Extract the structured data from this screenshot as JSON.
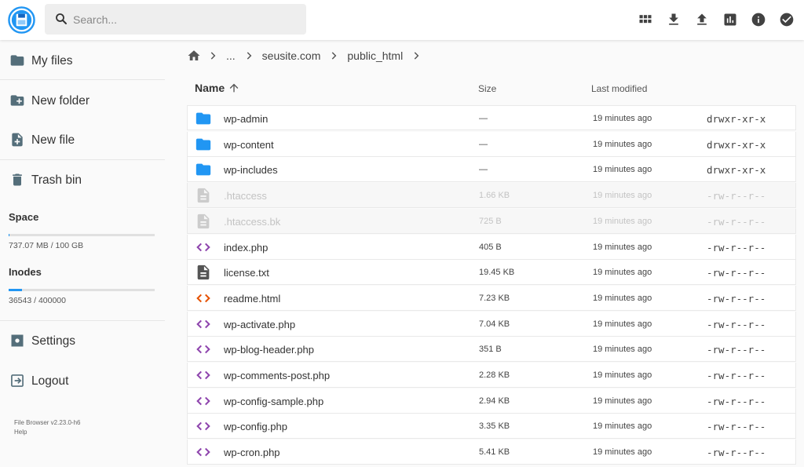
{
  "colors": {
    "accent": "#2196f3",
    "folder": "#2196f3",
    "php_icon": "#8e44ad",
    "html_icon": "#e65100",
    "doc_icon": "#555555",
    "hidden_icon": "#cccccc"
  },
  "header": {
    "logo_icon": "floppy-disk-icon",
    "search": {
      "placeholder": "Search..."
    },
    "actions": [
      {
        "name": "grid-view-icon"
      },
      {
        "name": "download-icon"
      },
      {
        "name": "upload-icon"
      },
      {
        "name": "chart-icon"
      },
      {
        "name": "info-icon"
      },
      {
        "name": "check-circle-icon"
      }
    ]
  },
  "sidebar": {
    "items": [
      {
        "label": "My files",
        "icon": "folder-icon"
      },
      {
        "label": "New folder",
        "icon": "create-new-folder-icon"
      },
      {
        "label": "New file",
        "icon": "note-add-icon"
      },
      {
        "label": "Trash bin",
        "icon": "delete-icon"
      }
    ],
    "space": {
      "title": "Space",
      "text": "737.07 MB / 100 GB",
      "fraction": 0.007
    },
    "inodes": {
      "title": "Inodes",
      "text": "36543 / 400000",
      "fraction": 0.091
    },
    "settings_label": "Settings",
    "logout_label": "Logout",
    "version": "File Browser v2.23.0-h6",
    "help": "Help"
  },
  "breadcrumb": {
    "ellipsis": "...",
    "parts": [
      "seusite.com",
      "public_html"
    ]
  },
  "table": {
    "name_header": "Name",
    "size_header": "Size",
    "modified_header": "Last modified",
    "rows": [
      {
        "name": "wp-admin",
        "size": "—",
        "modified": "19 minutes ago",
        "perm": "drwxr-xr-x",
        "kind": "folder",
        "hidden": false
      },
      {
        "name": "wp-content",
        "size": "—",
        "modified": "19 minutes ago",
        "perm": "drwxr-xr-x",
        "kind": "folder",
        "hidden": false
      },
      {
        "name": "wp-includes",
        "size": "—",
        "modified": "19 minutes ago",
        "perm": "drwxr-xr-x",
        "kind": "folder",
        "hidden": false
      },
      {
        "name": ".htaccess",
        "size": "1.66 KB",
        "modified": "19 minutes ago",
        "perm": "-rw-r--r--",
        "kind": "file",
        "hidden": true
      },
      {
        "name": ".htaccess.bk",
        "size": "725 B",
        "modified": "19 minutes ago",
        "perm": "-rw-r--r--",
        "kind": "file",
        "hidden": true
      },
      {
        "name": "index.php",
        "size": "405 B",
        "modified": "19 minutes ago",
        "perm": "-rw-r--r--",
        "kind": "php",
        "hidden": false
      },
      {
        "name": "license.txt",
        "size": "19.45 KB",
        "modified": "19 minutes ago",
        "perm": "-rw-r--r--",
        "kind": "text",
        "hidden": false
      },
      {
        "name": "readme.html",
        "size": "7.23 KB",
        "modified": "19 minutes ago",
        "perm": "-rw-r--r--",
        "kind": "html",
        "hidden": false
      },
      {
        "name": "wp-activate.php",
        "size": "7.04 KB",
        "modified": "19 minutes ago",
        "perm": "-rw-r--r--",
        "kind": "php",
        "hidden": false
      },
      {
        "name": "wp-blog-header.php",
        "size": "351 B",
        "modified": "19 minutes ago",
        "perm": "-rw-r--r--",
        "kind": "php",
        "hidden": false
      },
      {
        "name": "wp-comments-post.php",
        "size": "2.28 KB",
        "modified": "19 minutes ago",
        "perm": "-rw-r--r--",
        "kind": "php",
        "hidden": false
      },
      {
        "name": "wp-config-sample.php",
        "size": "2.94 KB",
        "modified": "19 minutes ago",
        "perm": "-rw-r--r--",
        "kind": "php",
        "hidden": false
      },
      {
        "name": "wp-config.php",
        "size": "3.35 KB",
        "modified": "19 minutes ago",
        "perm": "-rw-r--r--",
        "kind": "php",
        "hidden": false
      },
      {
        "name": "wp-cron.php",
        "size": "5.41 KB",
        "modified": "19 minutes ago",
        "perm": "-rw-r--r--",
        "kind": "php",
        "hidden": false
      }
    ]
  }
}
